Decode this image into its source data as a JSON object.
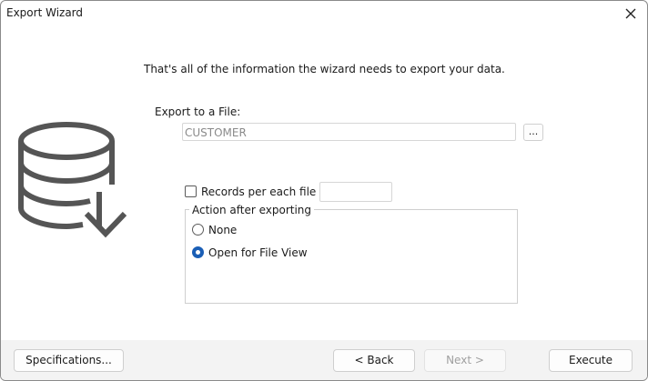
{
  "window": {
    "title": "Export Wizard"
  },
  "intro": "That's all of the information the wizard needs to export your data.",
  "export": {
    "label": "Export to a File:",
    "file_value": "CUSTOMER",
    "browse_label": "..."
  },
  "records": {
    "label": "Records per each file",
    "checked": false,
    "value": ""
  },
  "action_group": {
    "legend": "Action after exporting",
    "options": [
      {
        "label": "None",
        "selected": false
      },
      {
        "label": "Open for File View",
        "selected": true
      }
    ]
  },
  "buttons": {
    "specifications": "Specifications...",
    "back": "< Back",
    "next": "Next >",
    "execute": "Execute"
  },
  "colors": {
    "accent": "#1b5fb6",
    "icon": "#555555"
  }
}
